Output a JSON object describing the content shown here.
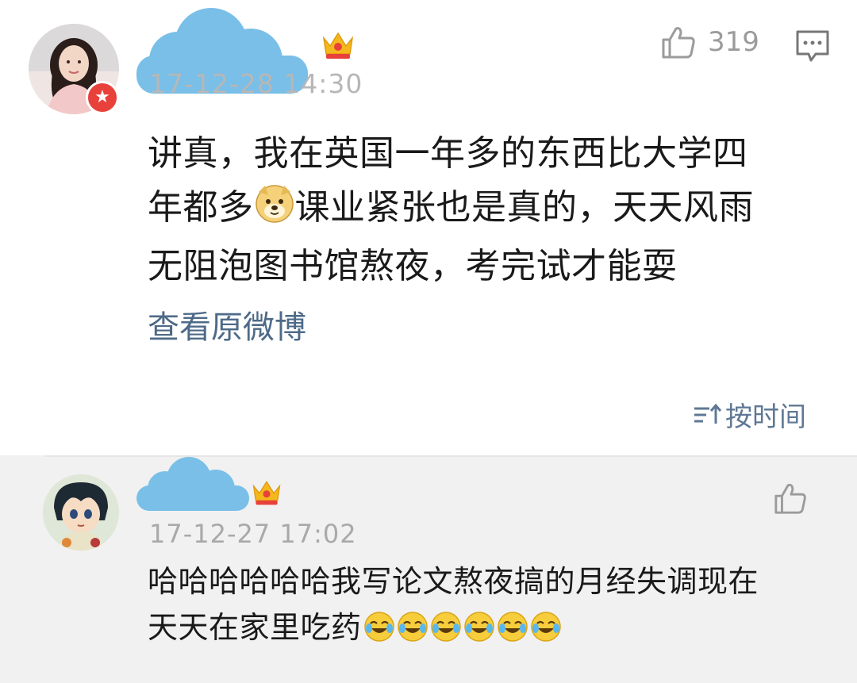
{
  "main_comment": {
    "avatar": "user-avatar-girl",
    "verified_icon": "star-icon",
    "username_masked": "cloud-mask",
    "crown_icon": "crown-icon",
    "timestamp": "17-12-28 14:30",
    "like_icon": "thumbs-up-icon",
    "like_count": "319",
    "reply_icon": "comment-bubble-icon",
    "text_lines": [
      "讲真，我在英国一年多的东西比大学四",
      "年都多",
      "课业紧张也是真的，天天风雨",
      "无阻泡图书馆熬夜，考完试才能耍"
    ],
    "inline_emoji": "doge-emoji",
    "view_original_label": "查看原微博",
    "sort_label": "按时间"
  },
  "reply": {
    "avatar": "user-avatar-anime",
    "username_masked": "cloud-mask",
    "crown_icon": "crown-icon",
    "timestamp": "17-12-27 17:02",
    "like_icon": "thumbs-up-icon",
    "text_lines": [
      "哈哈哈哈哈哈我写论文熬夜搞的月经失调现在",
      "天天在家里吃药"
    ],
    "trailing_emoji": "laugh-cry-emoji",
    "trailing_emoji_count": 6
  },
  "colors": {
    "link": "#4e6a88",
    "timestamp": "#b7b7b7",
    "mask": "#79bfe8",
    "reply_bg": "#f1f1f1",
    "badge": "#e8413b",
    "crown": "#f5b81c"
  }
}
